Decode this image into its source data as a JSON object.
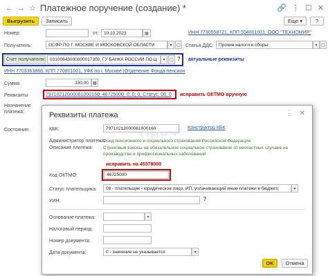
{
  "window": {
    "title": "Платежное поручение (создание) *"
  },
  "toolbar": {
    "post_close": "Выгрузить",
    "save": "Записать",
    "help": "?",
    "more": "Еще"
  },
  "form": {
    "number_label": "Номер:",
    "date_from_label": "от:",
    "date_value": "10.10.2023",
    "org_link": "ИНН 7730558721, КПП 504001001, ООО \"ТЕХНОМИР\"",
    "recipient_label": "Получатель:",
    "recipient_value": "ОСФР ПО Г. МОСКВЕ И МОСКОВСКОЙ ОБЛАСТИ",
    "dds_label": "Статья ДДС:",
    "dds_value": "Прочие налоги и сборы",
    "account_label": "Счет получателя:",
    "account_value": "03100643000000017300, ГУ БАНКА РОССИИ ПО Ц",
    "actual_note": "актуальные реквизиты",
    "recipient_link": "ИНН 7703363868, КПП 770801001, УФК по г. Москве (Отделение Фонда пенсион",
    "sum_label": "Сумма:",
    "sum_value": "330,00",
    "requisites_label": "Реквизиты",
    "requisites_link": "79710212000061000160; 46725000; 0; 0; 0; Статус: 08; 0",
    "oktmo_note": "исправить ОКТМО вручную",
    "purpose_label": "Назначение платежа:",
    "state_label": "Состояние:"
  },
  "dialog": {
    "title": "Реквизиты платежа",
    "kbk_label": "КБК:",
    "kbk_value": "79710212000061000160",
    "kbk_constructor": "Конструктор КБК",
    "admin_label": "Администратор платежа:",
    "admin_value": "Фонд пенсионного и социального страхования Российской Федерации",
    "desc_label": "Описание платежа:",
    "desc_value": "Страховые взносы на обязательное социальное страхование от несчастных случаев на производстве и профессиональных заболеваний",
    "fix_note": "исправить на 45378000",
    "oktmo_label": "Код ОКТМО:",
    "oktmo_value": "46725000",
    "status_label": "Статус плательщика:",
    "status_value": "08 - плательщик - юридическое лицо, ИП, уплачивающий иные платежи в бюджет(",
    "uin_label": "УИН:",
    "basis_label": "Основание платежа:",
    "tax_period_label": "Налоговый период:",
    "doc_num_label": "Номер документа:",
    "doc_date_label": "Дата документа:",
    "doc_date_value": "0 - значение не указывается",
    "ok": "OK",
    "cancel": "Отмена",
    "watermark": "ПроФ"
  },
  "colors": {
    "accent_yellow": "#f5d215",
    "link_blue": "#2a56b5",
    "note_red": "#d10000",
    "text_green": "#3d7a2e",
    "highlight_blue": "#1a2fa8"
  }
}
